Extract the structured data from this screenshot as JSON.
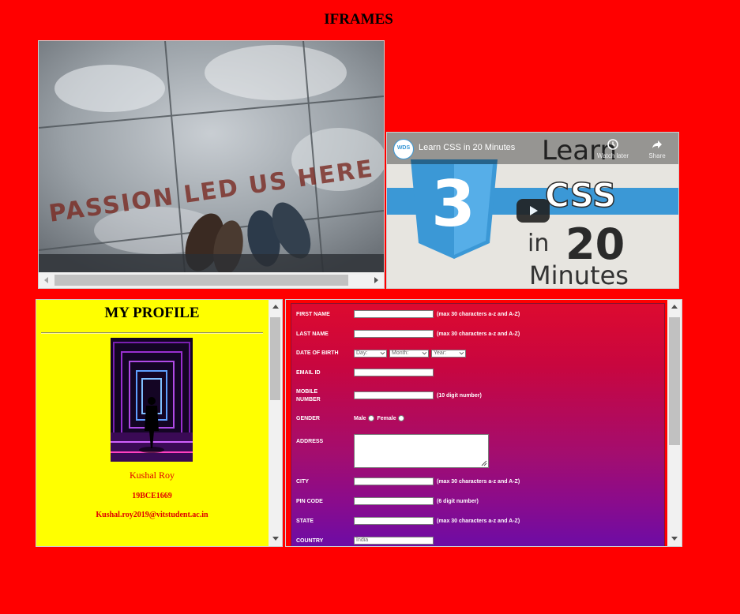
{
  "page": {
    "heading": "IFRAMES"
  },
  "image_frame": {
    "photo_caption": "PASSION LED US HERE"
  },
  "video_frame": {
    "channel_badge": "WDS",
    "title": "Learn CSS in 20 Minutes",
    "watch_later": "Watch later",
    "share": "Share",
    "thumb_word_learn": "Learn",
    "thumb_word_css": "CSS",
    "thumb_word_in": "in",
    "thumb_word_20": "20",
    "thumb_word_minutes": "Minutes",
    "shield_number": "3"
  },
  "profile": {
    "title": "MY PROFILE",
    "name": "Kushal Roy",
    "reg_no": "19BCE1669",
    "email": "Kushal.roy2019@vitstudent.ac.in"
  },
  "form": {
    "first_name": {
      "label": "FIRST NAME",
      "hint": "(max 30 characters a-z and A-Z)"
    },
    "last_name": {
      "label": "LAST NAME",
      "hint": "(max 30 characters a-z and A-Z)"
    },
    "dob": {
      "label": "DATE OF BIRTH",
      "day": "Day:",
      "month": "Month:",
      "year": "Year:"
    },
    "email": {
      "label": "EMAIL ID"
    },
    "mobile": {
      "label_line1": "MOBILE",
      "label_line2": "NUMBER",
      "hint": "(10 digit number)"
    },
    "gender": {
      "label": "GENDER",
      "male": "Male",
      "female": "Female"
    },
    "address": {
      "label": "ADDRESS"
    },
    "city": {
      "label": "CITY",
      "hint": "(max 30 characters a-z and A-Z)"
    },
    "pin": {
      "label": "PIN CODE",
      "hint": "(6 digit number)"
    },
    "state": {
      "label": "STATE",
      "hint": "(max 30 characters a-z and A-Z)"
    },
    "country": {
      "label": "COUNTRY",
      "value": "India"
    }
  },
  "colors": {
    "page_bg": "#ff0000",
    "profile_bg": "#ffff00",
    "profile_text": "#e00000",
    "css_blue": "#3b98d6",
    "youtube_play": "#212121"
  },
  "icons": [
    "clock-icon",
    "share-arrow-icon",
    "play-icon",
    "scroll-arrow-icon"
  ]
}
